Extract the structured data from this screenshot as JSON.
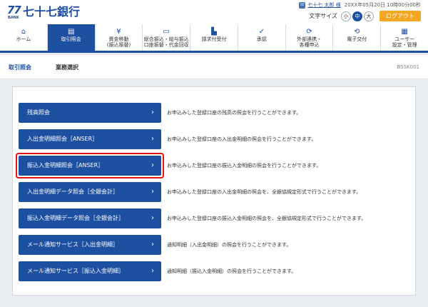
{
  "header": {
    "logo_num": "77",
    "logo_sub": "BANK",
    "bank_name": "七十七銀行",
    "user_icon": "ID",
    "user_name": "七十七 太郎 様",
    "datetime": "20XX年05月20日 10時00分00秒",
    "font_size_label": "文字サイズ",
    "font_sizes": [
      "小",
      "中",
      "大"
    ],
    "font_size_selected": "中",
    "logout_label": "ログアウト"
  },
  "gnav": [
    {
      "label": "ホーム",
      "icon": "home-icon",
      "glyph": "⌂"
    },
    {
      "label": "取引照会",
      "icon": "inquiry-icon",
      "glyph": "▤"
    },
    {
      "label": "資金移動\n(振込振替)",
      "icon": "transfer-icon",
      "glyph": "¥"
    },
    {
      "label": "総合振込・給与振込\n口座振替・代金回収",
      "icon": "bulk-transfer-icon",
      "glyph": "▭"
    },
    {
      "label": "請求付受付",
      "icon": "request-icon",
      "glyph": "▙"
    },
    {
      "label": "承認",
      "icon": "approval-icon",
      "glyph": "✓"
    },
    {
      "label": "外部連携・\n各種申込",
      "icon": "external-icon",
      "glyph": "⟳"
    },
    {
      "label": "電子交付",
      "icon": "electronic-delivery-icon",
      "glyph": "⟲"
    },
    {
      "label": "ユーザー\n設定・管理",
      "icon": "user-settings-icon",
      "glyph": "▦"
    }
  ],
  "gnav_active_index": 1,
  "breadcrumb": {
    "section": "取引照会",
    "title": "業務選択",
    "screen_id": "BSSK001"
  },
  "menu": [
    {
      "label": "残高照会",
      "desc": "お申込みした登録口座の残高の照会を行うことができます。"
    },
    {
      "label": "入出金明細照会［ANSER］",
      "desc": "お申込みした登録口座の入出金明細の照会を行うことができます。"
    },
    {
      "label": "振込入金明細照会［ANSER］",
      "desc": "お申込みした登録口座の振込入金明細の照会を行うことができます。"
    },
    {
      "label": "入出金明細データ照会［全銀会計］",
      "desc": "お申込みした登録口座の入出金明細の照会を、全銀協規定形式で行うことができます。"
    },
    {
      "label": "振込入金明細データ照会［全銀会計］",
      "desc": "お申込みした登録口座の振込入金明細の照会を、全銀協規定形式で行うことができます。"
    },
    {
      "label": "メール通知サービス［入出金明細］",
      "desc": "通知明細（入出金明細）の照会を行うことができます。"
    },
    {
      "label": "メール通知サービス［振込入金明細］",
      "desc": "通知明細（振込入金明細）の照会を行うことができます。"
    }
  ],
  "highlighted_index": 2,
  "colors": {
    "primary": "#1e50a2",
    "accent": "#f5a623",
    "highlight": "#e8101a"
  }
}
